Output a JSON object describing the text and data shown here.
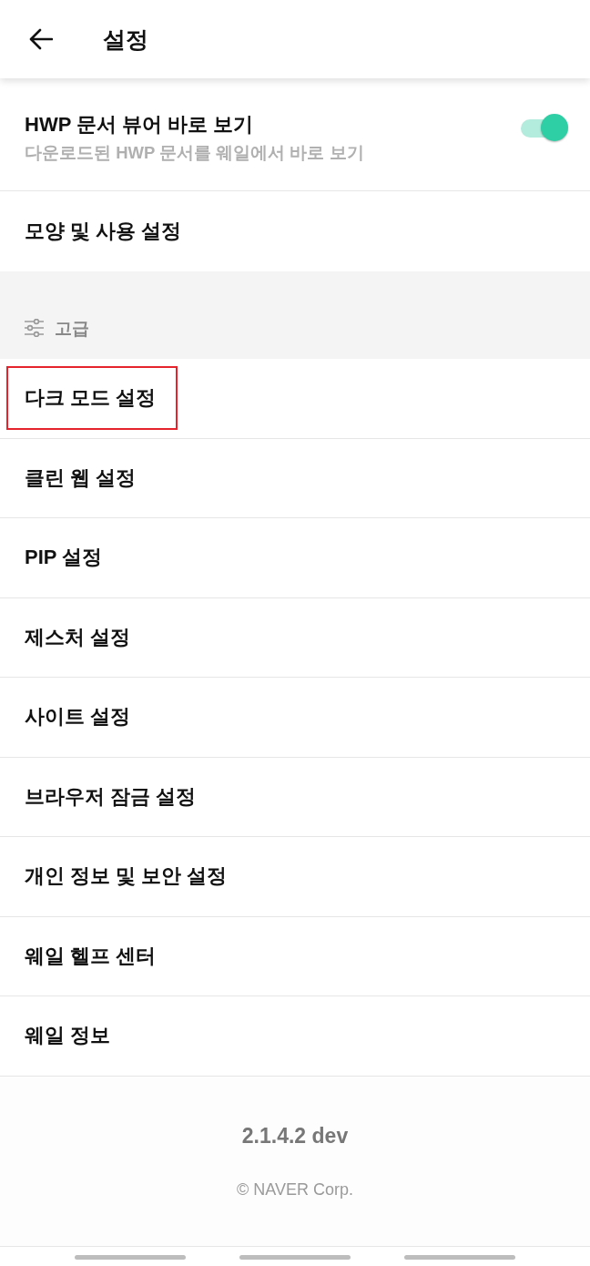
{
  "header": {
    "title": "설정"
  },
  "general_items": [
    {
      "kind": "toggle",
      "title": "HWP 문서 뷰어 바로 보기",
      "subtitle": "다운로드된 HWP 문서를 웨일에서 바로 보기",
      "on": true
    },
    {
      "kind": "link",
      "title": "모양 및 사용 설정"
    }
  ],
  "advanced_section": {
    "title": "고급",
    "items": [
      {
        "title": "다크 모드 설정",
        "highlighted": true
      },
      {
        "title": "클린 웹 설정",
        "highlighted": false
      },
      {
        "title": "PIP 설정",
        "highlighted": false
      },
      {
        "title": "제스처 설정",
        "highlighted": false
      },
      {
        "title": "사이트 설정",
        "highlighted": false
      },
      {
        "title": "브라우저 잠금 설정",
        "highlighted": false
      },
      {
        "title": "개인 정보 및 보안 설정",
        "highlighted": false
      },
      {
        "title": "웨일 헬프 센터",
        "highlighted": false
      },
      {
        "title": "웨일 정보",
        "highlighted": false
      }
    ]
  },
  "footer": {
    "version": "2.1.4.2 dev",
    "copyright": "© NAVER Corp."
  }
}
